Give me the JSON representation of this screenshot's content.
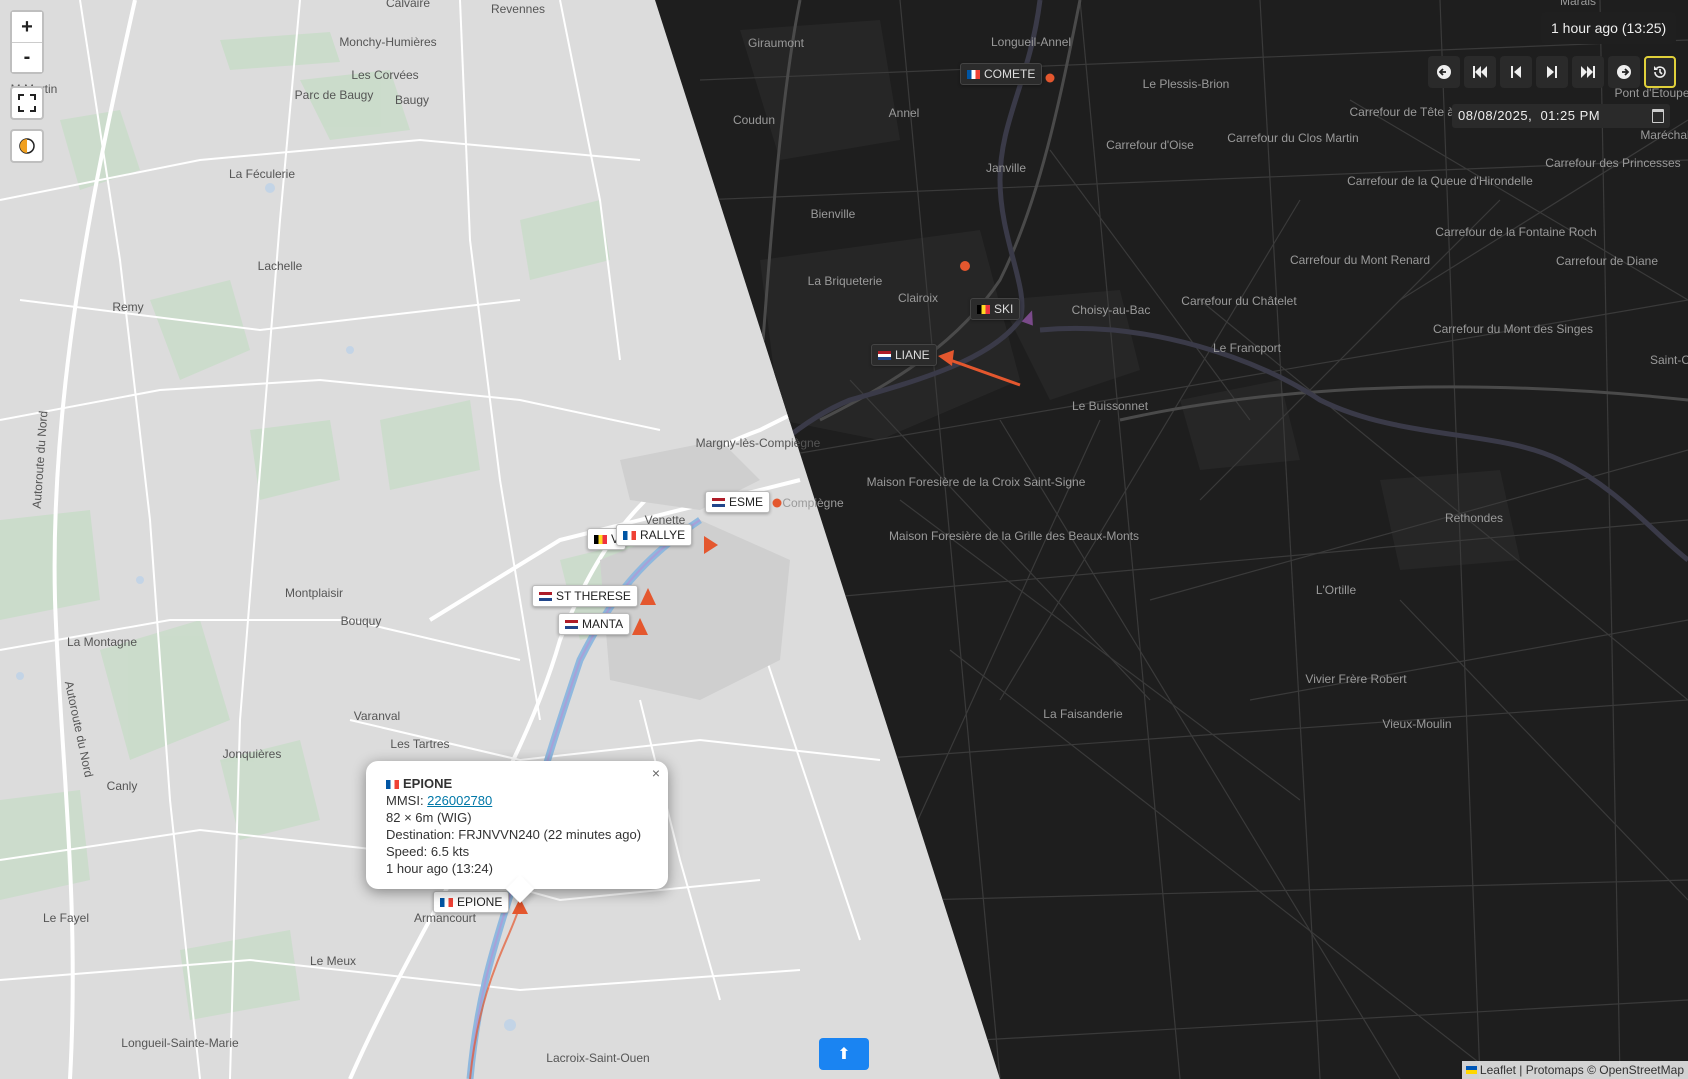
{
  "controls": {
    "zoom_in": "+",
    "zoom_out": "-"
  },
  "timebadge": "1 hour ago (13:25)",
  "datetime": {
    "month": "08",
    "day": "08",
    "year": "2025",
    "hour": "01",
    "minute": "25",
    "ampm": "PM"
  },
  "player_icons": [
    "circle-arrow-left-icon",
    "skip-back-icon",
    "step-back-icon",
    "step-forward-icon",
    "skip-forward-icon",
    "circle-arrow-right-icon",
    "history-icon"
  ],
  "vessels": [
    {
      "name": "COMETE",
      "flag": "fr",
      "theme": "dark"
    },
    {
      "name": "SKI",
      "flag": "be",
      "theme": "dark"
    },
    {
      "name": "LIANE",
      "flag": "nl",
      "theme": "dark"
    },
    {
      "name": "ESME",
      "flag": "nl",
      "theme": "light"
    },
    {
      "name": "V",
      "flag": "be",
      "theme": "light"
    },
    {
      "name": "RALLYE",
      "flag": "fr",
      "theme": "light"
    },
    {
      "name": "ST THERESE",
      "flag": "nl",
      "theme": "light"
    },
    {
      "name": "MANTA",
      "flag": "nl",
      "theme": "light"
    },
    {
      "name": "EPIONE",
      "flag": "fr",
      "theme": "light"
    }
  ],
  "popup": {
    "name": "EPIONE",
    "mmsi_label": "MMSI: ",
    "mmsi": "226002780",
    "size": "82 × 6m (WIG)",
    "destination": "Destination: FRJNVVN240 (22 minutes ago)",
    "speed": "Speed: 6.5 kts",
    "time": "1 hour ago (13:24)",
    "close": "×"
  },
  "places_light": [
    "Calvaire",
    "Revennes",
    "Monchy-Humières",
    "Les Corvées",
    "Parc de Baugy",
    "Baugy",
    "La Féculerie",
    "Lachelle",
    "Remy",
    "M Martin",
    "Autoroute du Nord",
    "Margny-lès-Compiègne",
    "Venette",
    "Montplaisir",
    "Bouquy",
    "La Montagne",
    "Autoroute du Nord",
    "Varanval",
    "Les Tartres",
    "Jonquières",
    "Canly",
    "Le Fayel",
    "Armancourt",
    "Le Meux",
    "Longueil-Sainte-Marie",
    "Lacroix-Saint-Ouen"
  ],
  "places_dark": [
    "Giraumont",
    "Longueil-Annel",
    "Le Plessis-Brion",
    "Coudun",
    "Annel",
    "Carrefour d'Oise",
    "Carrefour du Clos Martin",
    "Janville",
    "Bienville",
    "La Briqueterie",
    "Clairoix",
    "Choisy-au-Bac",
    "Carrefour du Mont Renard",
    "Carrefour du Châtelet",
    "Le Francport",
    "Le Buissonnet",
    "Compiègne",
    "Maison Foresière de la Croix Saint-Signe",
    "Maison Foresière de la Grille des Beaux-Monts",
    "Rethondes",
    "L'Ortille",
    "Vivier Frère Robert",
    "Vieux-Moulin",
    "La Faisanderie",
    "Carrefour de la Queue d'Hirondelle",
    "Carrefour de la Fontaine Roch",
    "Carrefour de Diane",
    "Carrefour du Mont des Singes",
    "Carrefour des Princesses",
    "Carrefour de Tête à Vache",
    "Pont d'Étoupe",
    "Marais",
    "Maréchal",
    "Saint-C"
  ],
  "upbutton_icon": "arrow-up-icon",
  "attribution": {
    "leaflet": "Leaflet",
    "rest": " | Protomaps © OpenStreetMap"
  }
}
